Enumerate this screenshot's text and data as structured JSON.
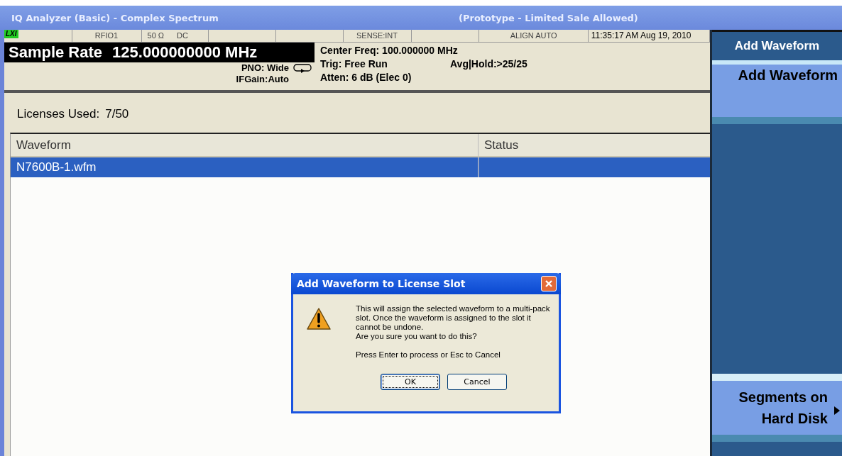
{
  "window": {
    "title": "IQ Analyzer (Basic) - Complex Spectrum",
    "subtitle": "(Prototype - Limited Sale Allowed)"
  },
  "status_bar": {
    "badge": "LXI",
    "cells": [
      "RFIO1",
      "50 Ω",
      "DC",
      "",
      "",
      "SENSE:INT",
      "",
      "ALIGN AUTO",
      "11:35:17 AM Aug 19, 2010"
    ]
  },
  "measurement": {
    "sample_rate_label": "Sample Rate",
    "sample_rate_value": "125.000000000 MHz",
    "pno": "PNO: Wide",
    "ifgain": "IFGain:Auto",
    "center_freq": "Center Freq: 100.000000 MHz",
    "trig": "Trig: Free Run",
    "avg_hold": "Avg|Hold:>25/25",
    "atten": "Atten: 6 dB (Elec 0)"
  },
  "licenses": {
    "label": "Licenses Used:",
    "value": "7/50"
  },
  "table": {
    "columns": [
      "Waveform",
      "Status"
    ],
    "rows": [
      {
        "cells": [
          "N7600B-1.wfm",
          ""
        ],
        "selected": true
      }
    ]
  },
  "softkeys": [
    {
      "kind": "title",
      "lines": [
        "Add Waveform"
      ]
    },
    {
      "kind": "key",
      "lines": [
        "Add Waveform"
      ]
    },
    {
      "kind": "submenu",
      "lines": [
        "Segments on",
        "Hard Disk"
      ]
    }
  ],
  "dialog": {
    "title": "Add Waveform to License Slot",
    "paragraphs": [
      [
        "This will assign the selected waveform to a multi-pack slot.  Once the waveform is assigned to the slot it cannot be undone.",
        "Are you sure you want to do this?"
      ],
      [
        "Press Enter to process or Esc to Cancel"
      ]
    ],
    "buttons": [
      {
        "label": "OK",
        "default": true
      },
      {
        "label": "Cancel",
        "default": false
      }
    ]
  }
}
